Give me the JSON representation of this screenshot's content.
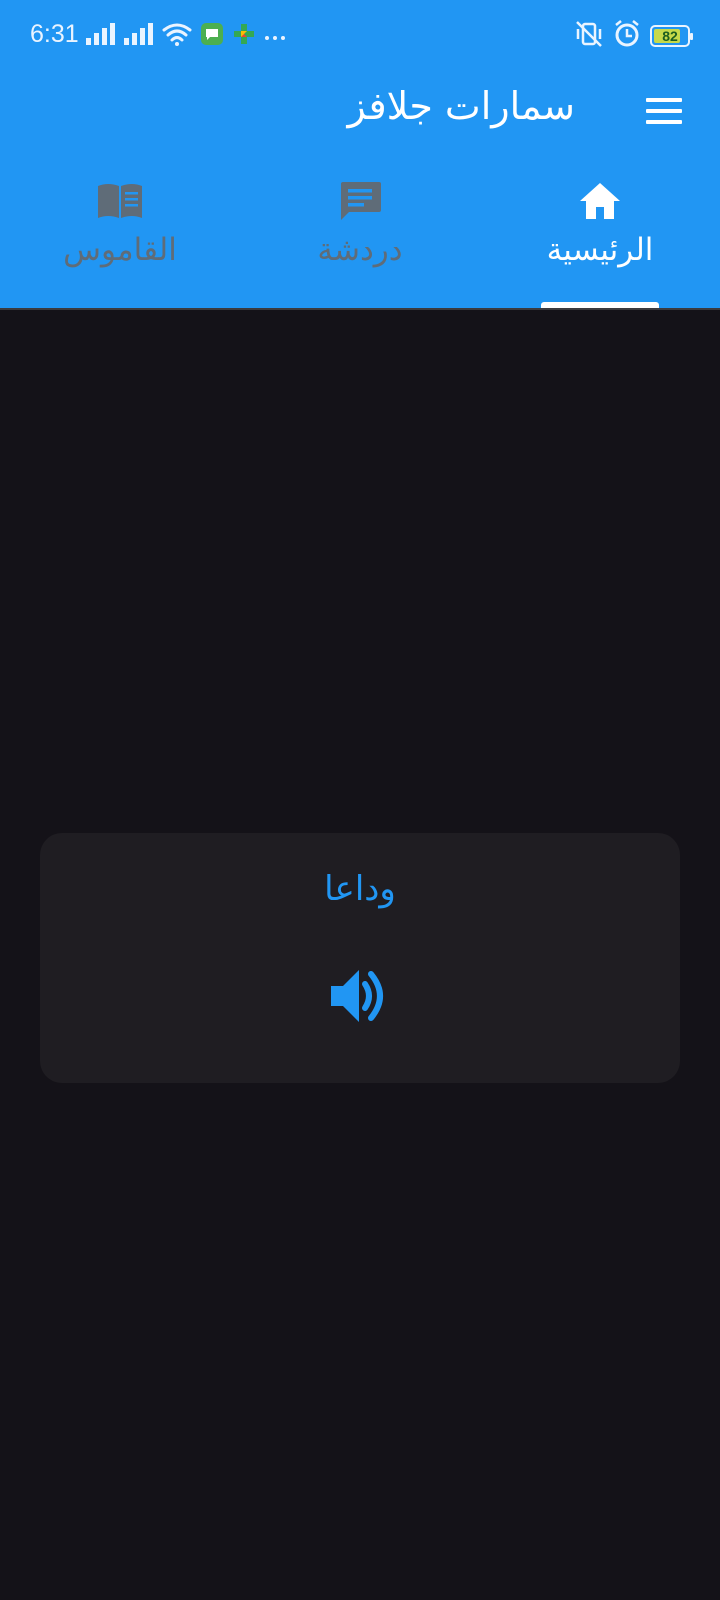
{
  "status_bar": {
    "time": "6:31",
    "battery_level": "82",
    "icons": [
      "signal-icon",
      "signal-icon",
      "wifi-icon",
      "message-app-icon",
      "play-games-icon",
      "more-dots-icon",
      "vibrate-off-icon",
      "alarm-icon",
      "battery-icon"
    ]
  },
  "app_bar": {
    "title": "سمارات جلافز",
    "menu_icon": "hamburger-menu-icon"
  },
  "tabs": [
    {
      "label": "الرئيسية",
      "icon": "home-icon",
      "active": true
    },
    {
      "label": "دردشة",
      "icon": "chat-icon",
      "active": false
    },
    {
      "label": "القاموس",
      "icon": "book-icon",
      "active": false
    }
  ],
  "card": {
    "word": "وداعا",
    "speaker_icon": "speaker-icon"
  },
  "colors": {
    "primary": "#2196F3",
    "background": "#141218",
    "card": "#1f1d22",
    "inactive_tab": "#5f6c78"
  }
}
